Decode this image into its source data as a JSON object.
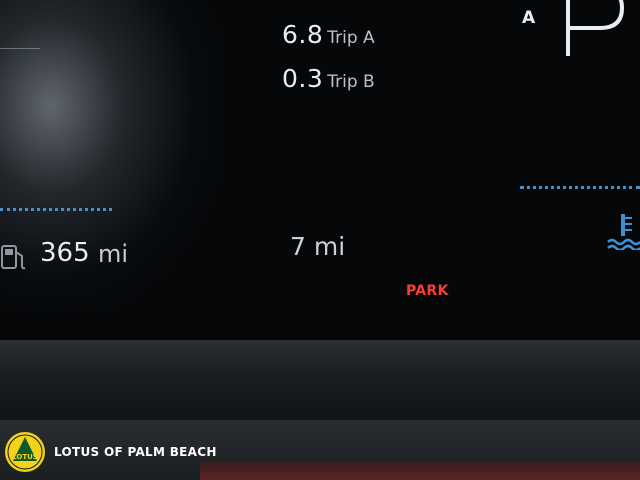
{
  "trip_a": {
    "value": "6.8",
    "label": "Trip A"
  },
  "trip_b": {
    "value": "0.3",
    "label": "Trip B"
  },
  "gear": {
    "mode_letter": "A",
    "selected": "P"
  },
  "range": {
    "value": "365",
    "unit": "mi"
  },
  "distance": {
    "value": "7 mi"
  },
  "status": {
    "text": "PARK",
    "color": "#ff3d2e"
  },
  "dealer": {
    "name": "LOTUS OF PALM BEACH",
    "logo_text": "LOTUS"
  },
  "icons": [
    "fuel-pump-icon",
    "coolant-temperature-icon",
    "lotus-logo"
  ],
  "colors": {
    "accent_dots": "#4a90c8",
    "text": "#e8edf2",
    "logo_yellow": "#f2d21b"
  }
}
